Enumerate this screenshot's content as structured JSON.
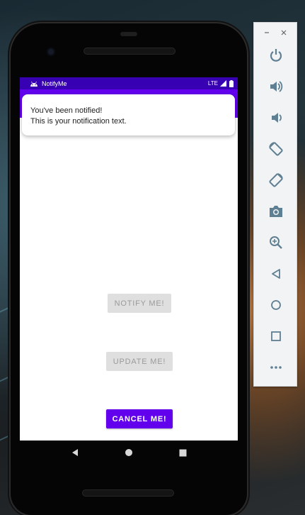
{
  "status_bar": {
    "app_name": "NotifyMe",
    "network": "LTE"
  },
  "notification": {
    "title": "You've been notified!",
    "text": "This is your notification text."
  },
  "buttons": {
    "notify": "NOTIFY ME!",
    "update": "UPDATE ME!",
    "cancel": "CANCEL ME!"
  },
  "colors": {
    "primary": "#6200ee",
    "primary_dark": "#3700b3",
    "disabled_bg": "#dfdfdf",
    "disabled_text": "#9a9a9a",
    "panel_icon": "#5f7f92"
  },
  "emulator_panel": {
    "window_controls": [
      "minimize-icon",
      "close-icon"
    ],
    "items": [
      "power-icon",
      "volume-up-icon",
      "volume-down-icon",
      "rotate-left-icon",
      "rotate-right-icon",
      "camera-icon",
      "zoom-icon",
      "back-icon",
      "home-icon",
      "overview-icon",
      "more-icon"
    ]
  },
  "android_nav": [
    "back-icon",
    "home-icon",
    "recents-icon"
  ]
}
